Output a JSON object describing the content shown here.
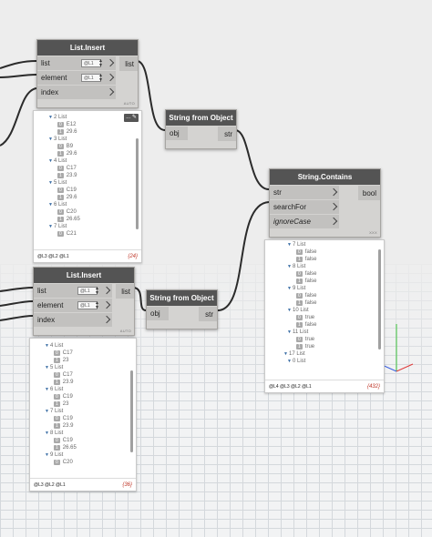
{
  "nodes": {
    "list_insert_1": {
      "title": "List.Insert",
      "inputs": [
        "list",
        "element",
        "index"
      ],
      "output": "list",
      "field_value": "@L1",
      "lacing": "AUTO"
    },
    "string_from_object_1": {
      "title": "String from Object",
      "input": "obj",
      "output": "str"
    },
    "string_contains": {
      "title": "String.Contains",
      "inputs": [
        "str",
        "searchFor",
        "ignoreCase"
      ],
      "output": "bool",
      "lacing": "XXX"
    },
    "list_insert_2": {
      "title": "List.Insert",
      "inputs": [
        "list",
        "element",
        "index"
      ],
      "output": "list",
      "field_value": "@L1",
      "lacing": "AUTO"
    },
    "string_from_object_2": {
      "title": "String from Object",
      "input": "obj",
      "output": "str"
    }
  },
  "previews": {
    "preview_1": {
      "pin_label": "...",
      "rows": [
        {
          "text": "2 List",
          "kind": "list"
        },
        {
          "idx": "0",
          "text": "E12"
        },
        {
          "idx": "1",
          "text": "29.6"
        },
        {
          "text": "3 List",
          "kind": "list"
        },
        {
          "idx": "0",
          "text": "B9"
        },
        {
          "idx": "1",
          "text": "29.6"
        },
        {
          "text": "4 List",
          "kind": "list"
        },
        {
          "idx": "0",
          "text": "C17"
        },
        {
          "idx": "1",
          "text": "23.9"
        },
        {
          "text": "5 List",
          "kind": "list"
        },
        {
          "idx": "0",
          "text": "C19"
        },
        {
          "idx": "1",
          "text": "29.6"
        },
        {
          "text": "6 List",
          "kind": "list"
        },
        {
          "idx": "0",
          "text": "C20"
        },
        {
          "idx": "1",
          "text": "26.65"
        },
        {
          "text": "7 List",
          "kind": "list"
        },
        {
          "idx": "0",
          "text": "C21"
        }
      ],
      "levels": "@L3 @L2 @L1",
      "count": "{24}"
    },
    "preview_contains": {
      "rows": [
        {
          "text": "7 List",
          "kind": "list"
        },
        {
          "idx": "0",
          "text": "false"
        },
        {
          "idx": "1",
          "text": "false"
        },
        {
          "text": "8 List",
          "kind": "list"
        },
        {
          "idx": "0",
          "text": "false"
        },
        {
          "idx": "1",
          "text": "false"
        },
        {
          "text": "9 List",
          "kind": "list"
        },
        {
          "idx": "0",
          "text": "false"
        },
        {
          "idx": "1",
          "text": "false"
        },
        {
          "text": "10 List",
          "kind": "list"
        },
        {
          "idx": "0",
          "text": "true"
        },
        {
          "idx": "1",
          "text": "false"
        },
        {
          "text": "11 List",
          "kind": "list"
        },
        {
          "idx": "0",
          "text": "true"
        },
        {
          "idx": "1",
          "text": "true"
        },
        {
          "text": "17 List",
          "kind": "list2"
        },
        {
          "text": "0 List",
          "kind": "list"
        }
      ],
      "levels": "@L4 @L3 @L2 @L1",
      "count": "{432}"
    },
    "preview_2": {
      "rows": [
        {
          "text": "4 List",
          "kind": "list"
        },
        {
          "idx": "0",
          "text": "C17"
        },
        {
          "idx": "1",
          "text": "23"
        },
        {
          "text": "5 List",
          "kind": "list"
        },
        {
          "idx": "0",
          "text": "C17"
        },
        {
          "idx": "1",
          "text": "23.9"
        },
        {
          "text": "6 List",
          "kind": "list"
        },
        {
          "idx": "0",
          "text": "C19"
        },
        {
          "idx": "1",
          "text": "23"
        },
        {
          "text": "7 List",
          "kind": "list"
        },
        {
          "idx": "0",
          "text": "C19"
        },
        {
          "idx": "1",
          "text": "23.9"
        },
        {
          "text": "8 List",
          "kind": "list"
        },
        {
          "idx": "0",
          "text": "C19"
        },
        {
          "idx": "1",
          "text": "26.65"
        },
        {
          "text": "9 List",
          "kind": "list"
        },
        {
          "idx": "0",
          "text": "C20"
        }
      ],
      "levels": "@L3 @L2 @L1",
      "count": "{36}"
    }
  },
  "colors": {
    "title_bar": "#545454",
    "node_body": "#d4d3d1",
    "count_text": "#c0392b",
    "wire": "#2b2b2b"
  }
}
